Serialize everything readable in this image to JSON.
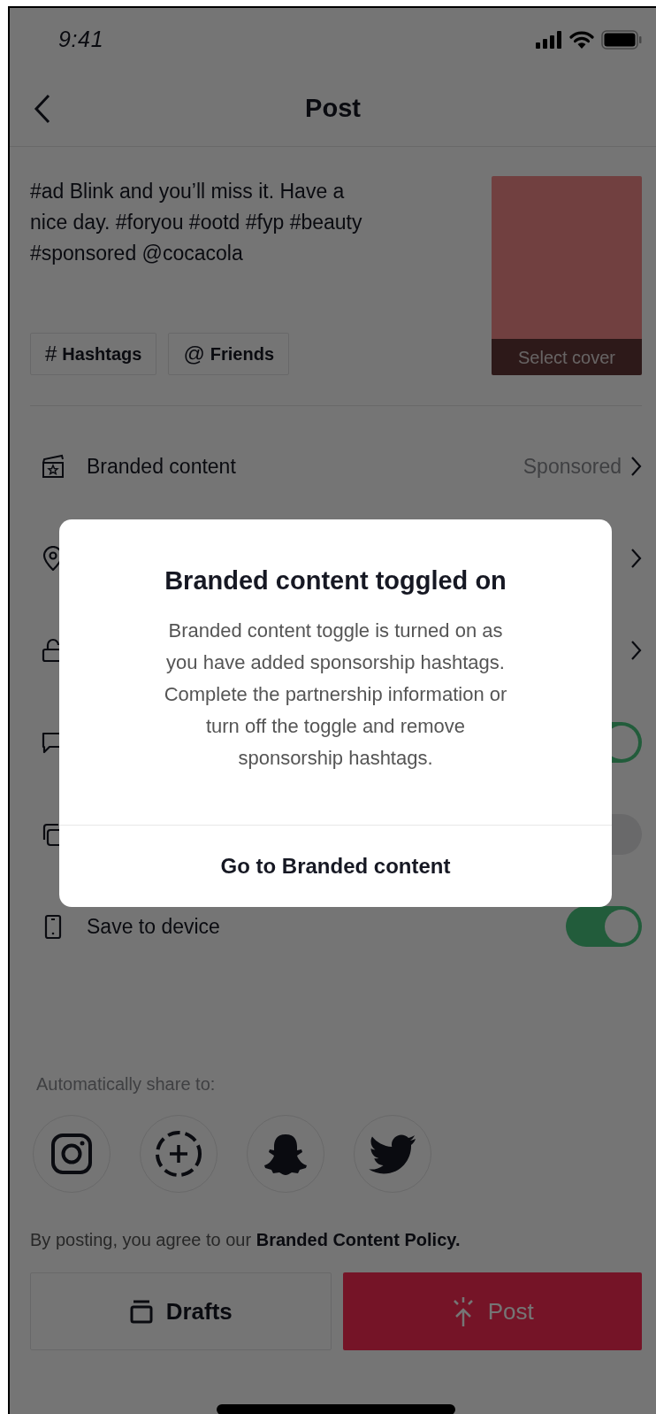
{
  "status_bar": {
    "time": "9:41"
  },
  "nav": {
    "title": "Post"
  },
  "caption": "#ad Blink and you’ll miss it. Have a\nnice day. #foryou #ootd #fyp #beauty\n#sponsored @cocacola",
  "chips": [
    {
      "symbol": "#",
      "label": "Hashtags"
    },
    {
      "symbol": "@",
      "label": "Friends"
    }
  ],
  "cover": {
    "label": "Select cover"
  },
  "settings": [
    {
      "kind": "link",
      "label": "Branded content",
      "value": "Sponsored"
    },
    {
      "kind": "link"
    },
    {
      "kind": "link"
    },
    {
      "kind": "toggle",
      "on": true
    },
    {
      "kind": "toggle",
      "on": false
    },
    {
      "kind": "toggle",
      "label": "Save to device",
      "on": true
    }
  ],
  "share": {
    "label": "Automatically share to:"
  },
  "policy": {
    "text": "By posting, you agree to our",
    "link": "Branded Content Policy."
  },
  "buttons": [
    {
      "kind": "secondary",
      "label": "Drafts"
    },
    {
      "kind": "primary",
      "label": "Post"
    }
  ],
  "dialog": {
    "title": "Branded content toggled on",
    "body": "Branded content toggle is turned on as\nyou have added sponsorship hashtags.\nComplete the partnership information or\nturn off the toggle and remove\nsponsorship hashtags.",
    "action": "Go to Branded content"
  }
}
